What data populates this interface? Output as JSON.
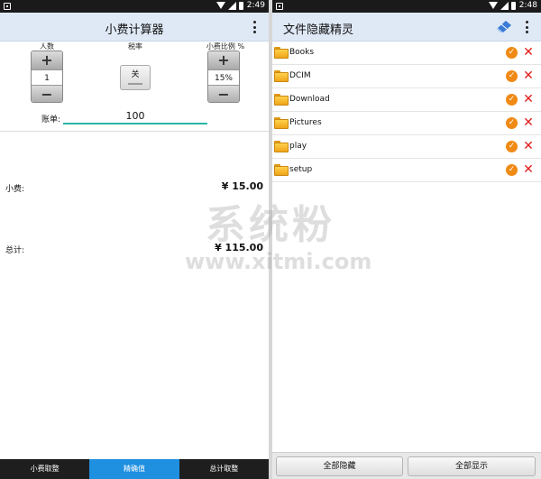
{
  "left": {
    "status": {
      "time": "2:49"
    },
    "appbar": {
      "title": "小费计算器"
    },
    "people": {
      "label": "人数",
      "value": "1",
      "plus": "+",
      "minus": "−"
    },
    "tax": {
      "label": "税率",
      "toggle": "关"
    },
    "tip_pct": {
      "label": "小费比例 %",
      "value": "15%",
      "plus": "+",
      "minus": "−"
    },
    "bill": {
      "label": "账单:",
      "value": "100"
    },
    "tip": {
      "label": "小费:",
      "value": "¥ 15.00"
    },
    "total": {
      "label": "总计:",
      "value": "¥ 115.00"
    },
    "tabs": [
      {
        "label": "小费取整",
        "active": false
      },
      {
        "label": "精确值",
        "active": true
      },
      {
        "label": "总计取整",
        "active": false
      }
    ]
  },
  "watermark": {
    "big": "系统粉",
    "url": "www.xitmi.com"
  },
  "right": {
    "status": {
      "time": "2:48"
    },
    "appbar": {
      "title": "文件隐藏精灵"
    },
    "folders": [
      {
        "name": "Books"
      },
      {
        "name": "DCIM"
      },
      {
        "name": "Download"
      },
      {
        "name": "Pictures"
      },
      {
        "name": "play"
      },
      {
        "name": "setup"
      }
    ],
    "buttons": {
      "hide_all": "全部隐藏",
      "show_all": "全部显示"
    }
  },
  "colors": {
    "accent": "#1f8fe0",
    "appbar": "#dfe9f6",
    "underline": "#2bb5a8",
    "check": "#f08a14",
    "delete": "#e01b1b",
    "folder": "#ffd24a"
  }
}
